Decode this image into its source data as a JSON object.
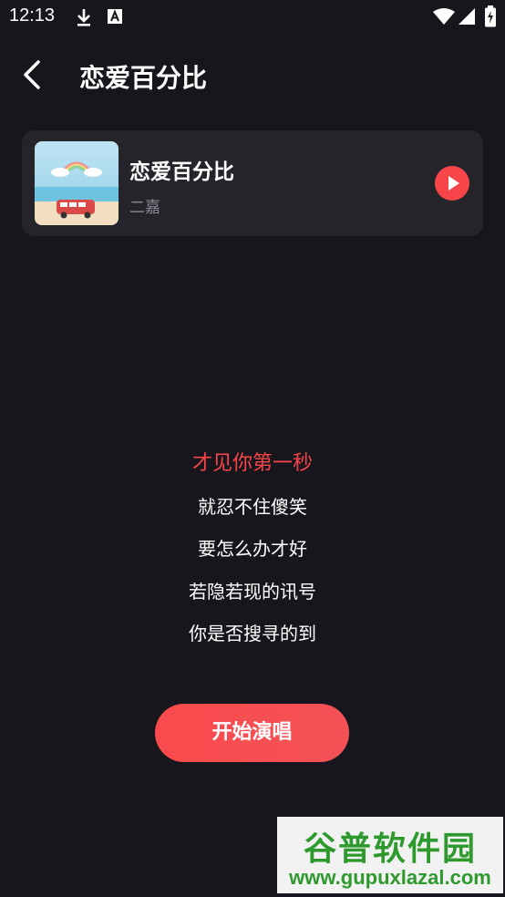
{
  "status_bar": {
    "time": "12:13",
    "icons": [
      "download-icon",
      "font-icon",
      "wifi-icon",
      "signal-icon",
      "battery-icon"
    ]
  },
  "header": {
    "title": "恋爱百分比",
    "back_icon": "chevron-left-icon"
  },
  "song": {
    "title": "恋爱百分比",
    "artist": "二嘉",
    "play_icon": "play-icon"
  },
  "lyrics": [
    {
      "text": "才见你第一秒",
      "active": true
    },
    {
      "text": "就忍不住傻笑",
      "active": false
    },
    {
      "text": "要怎么办才好",
      "active": false
    },
    {
      "text": "若隐若现的讯号",
      "active": false
    },
    {
      "text": "你是否搜寻的到",
      "active": false
    }
  ],
  "start_button": {
    "label": "开始演唱"
  },
  "watermark": {
    "title": "谷普软件园",
    "url": "www.gupuxlazal.com"
  },
  "colors": {
    "background": "#17161c",
    "card": "#25242b",
    "accent": "#f7454a",
    "secondary_text": "#8b8a93",
    "watermark_green": "#2e9a2e"
  }
}
